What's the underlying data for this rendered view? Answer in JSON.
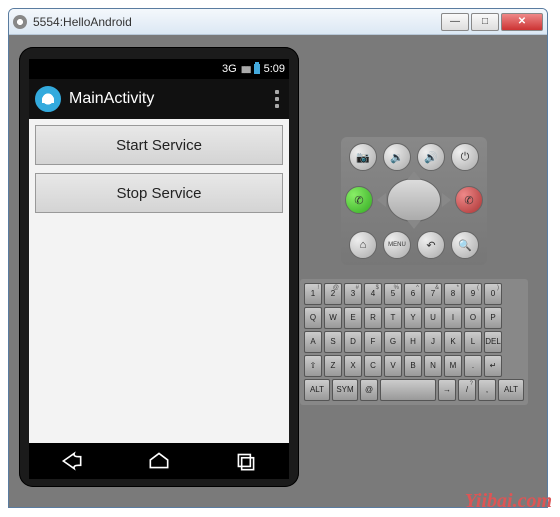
{
  "window": {
    "title": "5554:HelloAndroid"
  },
  "statusbar": {
    "network": "3G",
    "time": "5:09"
  },
  "appbar": {
    "title": "MainActivity"
  },
  "buttons": {
    "start": "Start Service",
    "stop": "Stop Service"
  },
  "controls": {
    "camera": "camera",
    "volDown": "vol-down",
    "volUp": "vol-up",
    "power": "power",
    "call": "call",
    "end": "end-call",
    "home": "home",
    "menu": "MENU",
    "back": "back",
    "search": "search"
  },
  "keyboard": {
    "row1": [
      {
        "m": "1",
        "s": "!"
      },
      {
        "m": "2",
        "s": "@"
      },
      {
        "m": "3",
        "s": "#"
      },
      {
        "m": "4",
        "s": "$"
      },
      {
        "m": "5",
        "s": "%"
      },
      {
        "m": "6",
        "s": "^"
      },
      {
        "m": "7",
        "s": "&"
      },
      {
        "m": "8",
        "s": "*"
      },
      {
        "m": "9",
        "s": "("
      },
      {
        "m": "0",
        "s": ")"
      }
    ],
    "row2": [
      {
        "m": "Q"
      },
      {
        "m": "W"
      },
      {
        "m": "E"
      },
      {
        "m": "R"
      },
      {
        "m": "T"
      },
      {
        "m": "Y"
      },
      {
        "m": "U"
      },
      {
        "m": "I"
      },
      {
        "m": "O"
      },
      {
        "m": "P"
      }
    ],
    "row3": [
      {
        "m": "A"
      },
      {
        "m": "S"
      },
      {
        "m": "D"
      },
      {
        "m": "F"
      },
      {
        "m": "G"
      },
      {
        "m": "H"
      },
      {
        "m": "J"
      },
      {
        "m": "K"
      },
      {
        "m": "L"
      },
      {
        "m": "DEL"
      }
    ],
    "row4": [
      {
        "m": "⇧"
      },
      {
        "m": "Z"
      },
      {
        "m": "X"
      },
      {
        "m": "C"
      },
      {
        "m": "V"
      },
      {
        "m": "B"
      },
      {
        "m": "N"
      },
      {
        "m": "M"
      },
      {
        "m": "."
      },
      {
        "m": "↵"
      }
    ],
    "row5": [
      {
        "m": "ALT",
        "w": "wide"
      },
      {
        "m": "SYM",
        "w": "wide"
      },
      {
        "m": "@"
      },
      {
        "m": "",
        "w": "sp"
      },
      {
        "m": "→"
      },
      {
        "m": "/",
        "s": "?"
      },
      {
        "m": ","
      },
      {
        "m": "ALT",
        "w": "wide"
      }
    ]
  },
  "watermark": "Yiibai.com"
}
